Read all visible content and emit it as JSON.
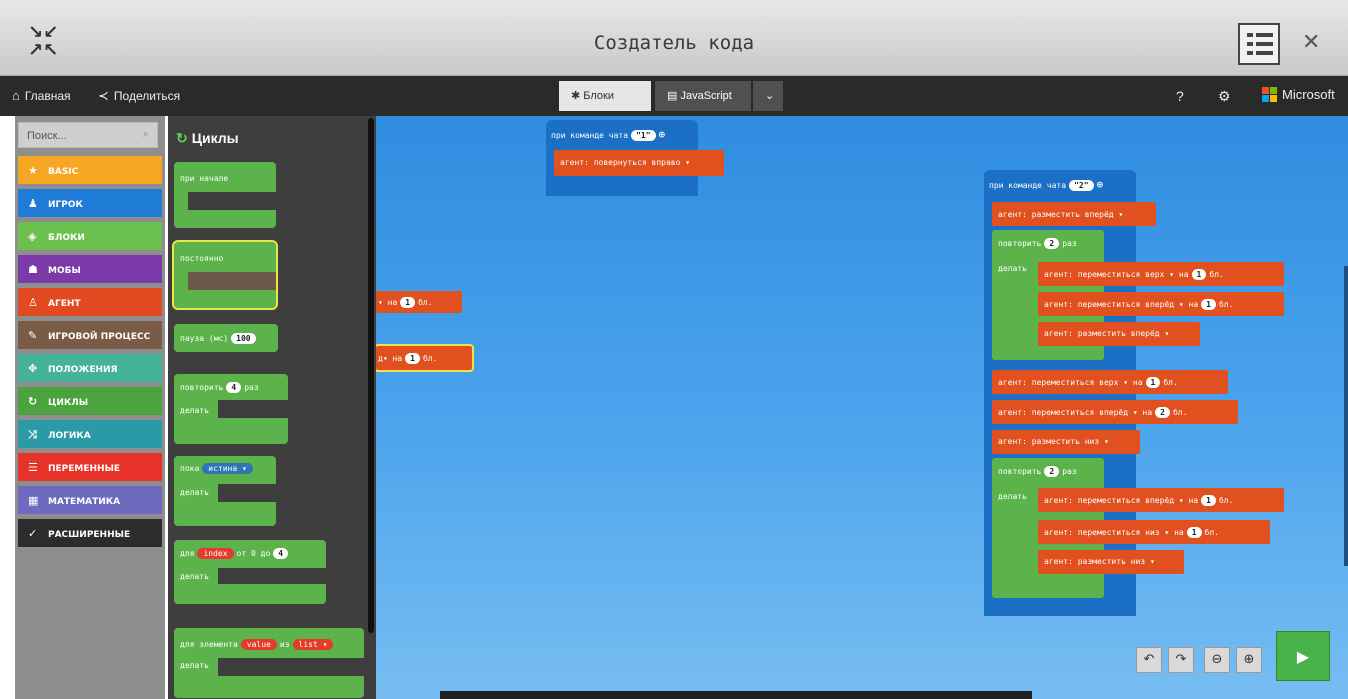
{
  "window": {
    "title": "Создатель кода"
  },
  "menubar": {
    "home": "Главная",
    "share": "Поделиться",
    "tabs": [
      "Блоки",
      "JavaScript"
    ],
    "brand": "Microsoft"
  },
  "sidebar": {
    "search_placeholder": "Поиск...",
    "categories": [
      {
        "label": "BASIC",
        "color": "#f5a623",
        "icon": "★"
      },
      {
        "label": "ИГРОК",
        "color": "#1e7bd6",
        "icon": "♟"
      },
      {
        "label": "БЛОКИ",
        "color": "#6cc14e",
        "icon": "◈"
      },
      {
        "label": "МОБЫ",
        "color": "#7b3aa8",
        "icon": "☗"
      },
      {
        "label": "АГЕНТ",
        "color": "#e14a20",
        "icon": "♙"
      },
      {
        "label": "ИГРОВОЙ ПРОЦЕСС",
        "color": "#7a5b46",
        "icon": "✎"
      },
      {
        "label": "ПОЛОЖЕНИЯ",
        "color": "#44b39a",
        "icon": "✥"
      },
      {
        "label": "ЦИКЛЫ",
        "color": "#4aa33c",
        "icon": "↻"
      },
      {
        "label": "ЛОГИКА",
        "color": "#2a9ba6",
        "icon": "⤨"
      },
      {
        "label": "ПЕРЕМЕННЫЕ",
        "color": "#e8332a",
        "icon": "☰"
      },
      {
        "label": "МАТЕМАТИКА",
        "color": "#6d6abf",
        "icon": "▦"
      },
      {
        "label": "РАСШИРЕННЫЕ",
        "color": "#2c2c2c",
        "icon": "✓"
      }
    ]
  },
  "flyout": {
    "title": "Циклы",
    "blocks": {
      "on_start": "при начале",
      "forever": "постоянно",
      "pause": "пауза (мс)",
      "pause_value": "100",
      "repeat": "повторить",
      "repeat_value": "4",
      "times": "раз",
      "do": "делать",
      "while": "пока",
      "while_cond": "истина",
      "for": "для",
      "for_var": "index",
      "from": "от 0 до",
      "for_to": "4",
      "for_each": "для элемента",
      "each_var": "value",
      "in": "из",
      "list_var": "list"
    }
  },
  "workspace": {
    "ghost1": "на",
    "ghost1_val": "1",
    "ghost1_unit": "бл.",
    "ghost2_pre": "д",
    "ghost2": "на",
    "ghost2_val": "1",
    "ghost2_unit": "бл.",
    "script1": {
      "hat": "при команде чата",
      "hat_value": "\"1\"",
      "turn": "агент: повернуться",
      "turn_dir": "вправо"
    },
    "script2": {
      "hat": "при команде чата",
      "hat_value": "\"2\"",
      "place_fwd": "агент: разместить",
      "fwd": "вперёд",
      "repeat": "повторить",
      "repeat1": "2",
      "times": "раз",
      "do": "делать",
      "move": "агент: переместиться",
      "up": "верх",
      "down": "низ",
      "on": "на",
      "blocks_unit": "бл.",
      "v1": "1",
      "v2": "2",
      "place_down": "агент: разместить",
      "down_dir": "низ"
    }
  },
  "controls": {
    "undo": "↶",
    "redo": "↷",
    "zoom_out": "⊖",
    "zoom_in": "⊕",
    "run": "▶"
  }
}
